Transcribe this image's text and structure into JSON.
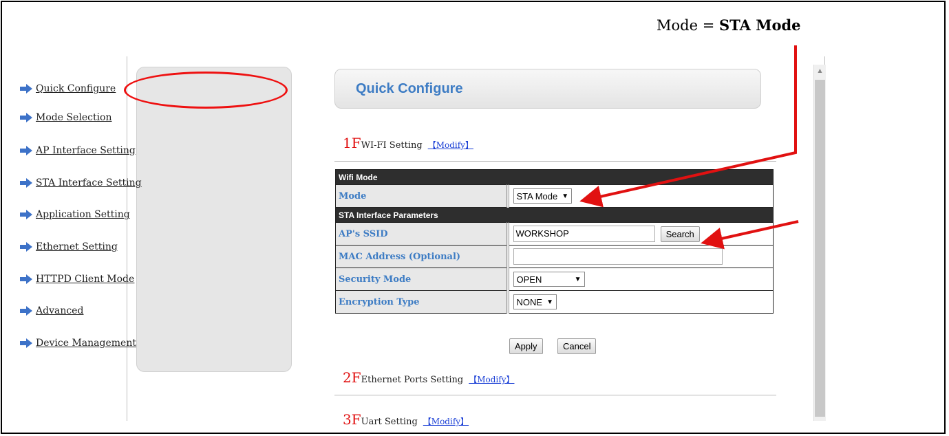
{
  "annotation": {
    "prefix": "Mode = ",
    "value": "STA Mode"
  },
  "sidebar": {
    "items": [
      {
        "label": "Quick Configure"
      },
      {
        "label": "Mode Selection"
      },
      {
        "label": "AP Interface Setting"
      },
      {
        "label": "STA Interface Setting"
      },
      {
        "label": "Application Setting"
      },
      {
        "label": "Ethernet Setting"
      },
      {
        "label": "HTTPD Client Mode"
      },
      {
        "label": "Advanced"
      },
      {
        "label": "Device Management"
      }
    ]
  },
  "main": {
    "title": "Quick Configure",
    "sections": [
      {
        "num": "1F",
        "label": "WI-FI Setting",
        "link": "【Modify】"
      },
      {
        "num": "2F",
        "label": "Ethernet Ports Setting",
        "link": "【Modify】"
      },
      {
        "num": "3F",
        "label": "Uart Setting",
        "link": "【Modify】"
      }
    ],
    "wifi_table": {
      "wifi_mode_header": "Wifi Mode",
      "mode_label": "Mode",
      "mode_value": "STA Mode",
      "sta_header": "STA Interface Parameters",
      "ssid_label": "AP's SSID",
      "ssid_value": "WORKSHOP",
      "search_label": "Search",
      "mac_label": "MAC Address (Optional)",
      "mac_value": "",
      "security_label": "Security Mode",
      "security_value": "OPEN",
      "encryption_label": "Encryption Type",
      "encryption_value": "NONE"
    },
    "apply_label": "Apply",
    "cancel_label": "Cancel"
  },
  "colors": {
    "annotation_red": "#e11111",
    "title_blue": "#3d7cc4",
    "link_blue": "#1a3fd6"
  },
  "icons": {
    "sidebar_item": "right-arrow-icon"
  }
}
